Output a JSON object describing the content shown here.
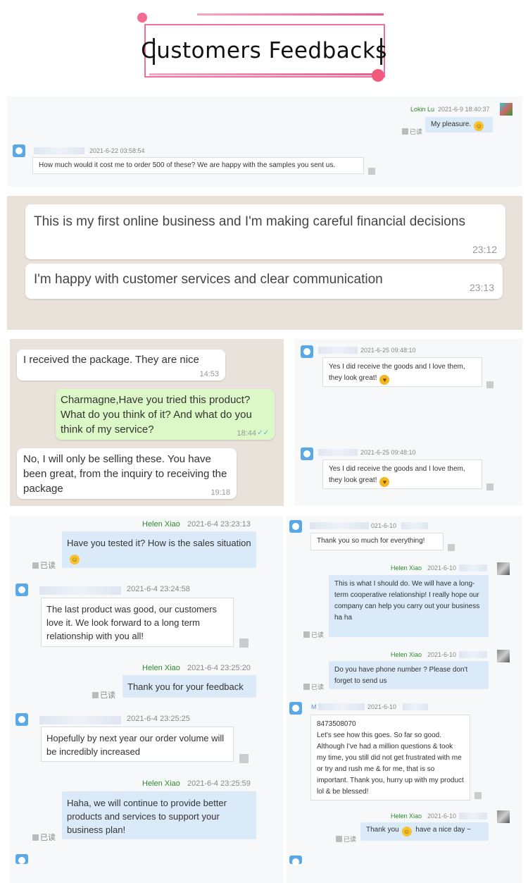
{
  "header": {
    "title": "Customers Feedbacks"
  },
  "chat1": {
    "seller_name": "Lokin Lu",
    "seller_ts": "2021-6-9 18:40:37",
    "seller_msg": "My pleasure.",
    "read": "已读",
    "buyer_ts": "2021-6-22 03:58:54",
    "buyer_msg": "How much would it cost me to order 500 of these?  We are happy with the samples you sent us."
  },
  "chat2": {
    "msg1": "This is my first online business and I'm making careful financial decisions",
    "time1": "23:12",
    "msg2": "I'm happy with customer services and clear communication",
    "time2": "23:13"
  },
  "chat3": {
    "msg1": "I received the package. They are nice",
    "time1": "14:53",
    "msg2": "Charmagne,Have you tried this product? What do you think of it? And what do you think of my service?",
    "time2": "18:44",
    "msg3": "No, I will only be selling these. You have been great, from the inquiry to receiving the package",
    "time3": "19:18"
  },
  "chat4": {
    "ts1": "2021-6-25 09:48:10",
    "msg1": "Yes I did receive the goods and I love them, they look great!",
    "ts2": "2021-6-25 09:48:10",
    "msg2": "Yes I did receive the goods and I love them, they look great!"
  },
  "chat5": {
    "seller": "Helen Xiao",
    "ts1": "2021-6-4 23:23:13",
    "msg1": "Have you tested it? How is the sales situation",
    "read": "已读",
    "ts2": "2021-6-4 23:24:58",
    "msg2": "The last product was good, our customers love it. We look forward to a long term relationship with you all!",
    "ts3": "2021-6-4 23:25:20",
    "msg3": "Thank you for your feedback",
    "ts4": "2021-6-4 23:25:25",
    "msg4": "Hopefully by next year our order volume will be incredibly increased",
    "ts5": "2021-6-4 23:25:59",
    "msg5": "Haha, we will continue to provide better products and services to support your business plan!"
  },
  "chat6": {
    "ts1": "021-6-10",
    "msg1": "Thank you so much for everything!",
    "seller": "Helen Xiao",
    "ts2": "2021-6-10",
    "msg2": "This is what I should do. We will have a long-term cooperative relationship! I really hope our company can help you carry out your business ha ha",
    "read": "已读",
    "ts3": "2021-6-10",
    "msg3": "Do you have phone number ? Please don't forget to send us",
    "buyer_initial": "M",
    "ts4": "2021-6-10",
    "msg4_phone": "8473508070",
    "msg4": "Let's see how this goes. So far so good. Although I've had a million questions & took my time, you still did not get frustrated with me or try and rush me & for me, that is so important. Thank you, hurry up with my product lol & be blessed!",
    "ts5": "2021-6-10",
    "msg5a": "Thank you",
    "msg5b": "have a nice day ~"
  }
}
